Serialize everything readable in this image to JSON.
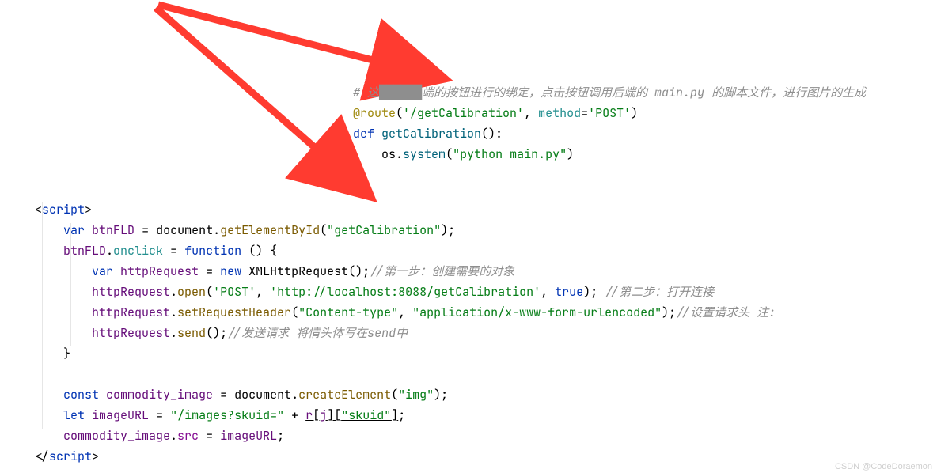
{
  "python": {
    "comment_prefix": "# 这",
    "comment_obscured": "██████",
    "comment_rest_a": "端的按钮进行的绑定，点击按钮调用后端的 ",
    "comment_main": "main.py",
    "comment_rest_b": " 的脚本文件，进行图片的生成",
    "decorator": "@route",
    "route_path": "'/getCalibration'",
    "method_kw": "method",
    "method_val": "'POST'",
    "def": "def",
    "fn_name": "getCalibration",
    "os": "os",
    "system": "system",
    "system_arg": "\"python main.py\""
  },
  "js": {
    "script_open": "script",
    "script_close": "script",
    "var": "var",
    "btnFLD": "btnFLD",
    "document": "document",
    "getElementById": "getElementById",
    "getCalibration_str": "\"getCalibration\"",
    "onclick": "onclick",
    "function": "function",
    "httpRequest": "httpRequest",
    "new": "new",
    "XMLHttpRequest": "XMLHttpRequest",
    "comment_step1": "//第一步：创建需要的对象",
    "open": "open",
    "post_str": "'POST'",
    "url_str": "'http://localhost:8088/getCalibration'",
    "true": "true",
    "comment_step2": "//第二步：打开连接",
    "setRequestHeader": "setRequestHeader",
    "ct_key": "\"Content-type\"",
    "ct_val": "\"application/x-www-form-urlencoded\"",
    "comment_hdr": "//设置请求头 注:",
    "send": "send",
    "comment_send": "//发送请求 将情头体写在",
    "send_italic": "send",
    "send_tail": "中",
    "const": "const",
    "commodity_image": "commodity_image",
    "createElement": "createElement",
    "img_str": "\"img\"",
    "let": "let",
    "imageURL": "imageURL",
    "images_str": "\"/images?skuid=\"",
    "r": "r",
    "j": "j",
    "skuid_str": "\"skuid\"",
    "src": "src"
  },
  "watermark": "CSDN @CodeDoraemon",
  "arrow_color": "#ff3b30"
}
